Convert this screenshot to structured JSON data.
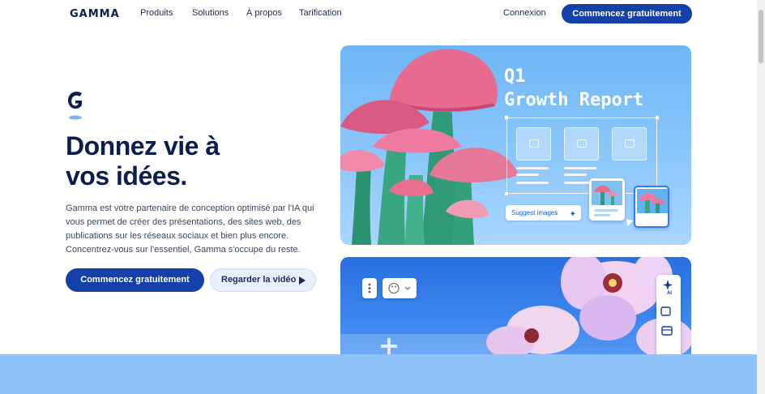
{
  "header": {
    "logo": "GAMMA",
    "nav": [
      "Produits",
      "Solutions",
      "À propos",
      "Tarification"
    ],
    "login": "Connexion",
    "cta": "Commencez gratuitement"
  },
  "hero": {
    "title_line1": "Donnez vie à",
    "title_line2": "vos idées.",
    "description": "Gamma est votre partenaire de conception optimisé par l'IA qui vous permet de créer des présentations, des sites web, des publications sur les réseaux sociaux et bien plus encore. Concentrez-vous sur l'essentiel, Gamma s'occupe du reste.",
    "cta_primary": "Commencez gratuitement",
    "cta_video": "Regarder la vidéo"
  },
  "card1": {
    "title_line1": "Q1",
    "title_line2": "Growth Report",
    "suggest_label": "Suggest images"
  },
  "card2": {
    "ai_badge": "AI"
  },
  "colors": {
    "brand_blue": "#1341a8",
    "navy": "#0b1e4d",
    "card_sky": "#8cc7fb",
    "band": "#8fc3f9"
  }
}
